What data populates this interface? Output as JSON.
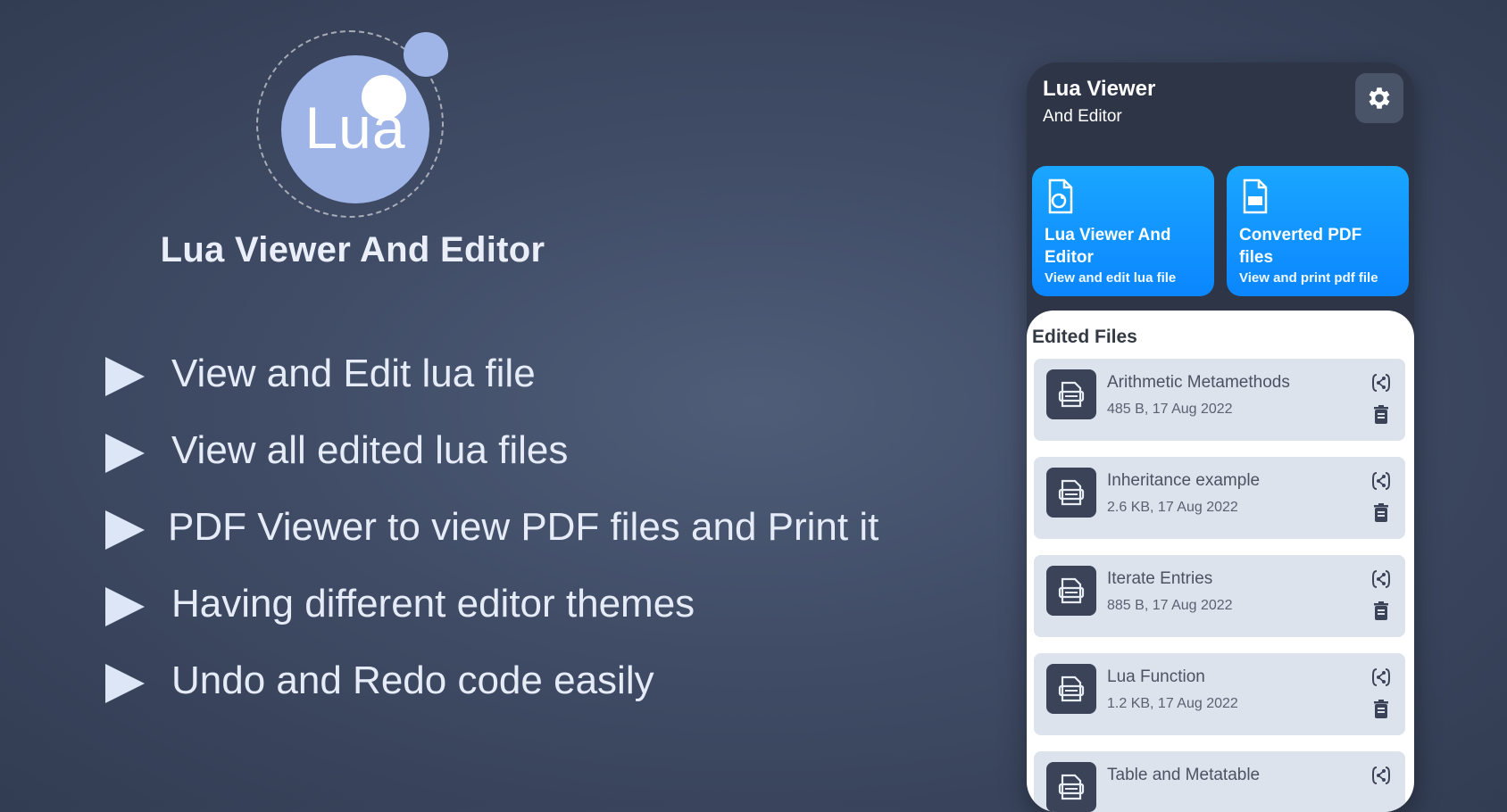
{
  "logo": {
    "text": "Lua"
  },
  "promo": {
    "app_title": "Lua Viewer And Editor",
    "features": [
      "View and Edit lua file",
      "View all edited lua files",
      "PDF Viewer to view PDF files and Print it",
      "Having different editor themes",
      "Undo and Redo code easily"
    ]
  },
  "phone": {
    "header": {
      "title": "Lua Viewer",
      "subtitle": "And Editor",
      "settings_icon": "gear-icon"
    },
    "cards": [
      {
        "title": "Lua Viewer And Editor",
        "desc": "View and edit lua file",
        "icon": "lua-file-icon"
      },
      {
        "title": "Converted PDF files",
        "desc": "View and print pdf file",
        "icon": "pdf-file-icon"
      }
    ],
    "edited_files": {
      "title": "Edited Files",
      "items": [
        {
          "name": "Arithmetic Metamethods",
          "meta": "485 B, 17 Aug 2022"
        },
        {
          "name": "Inheritance example",
          "meta": "2.6 KB, 17 Aug 2022"
        },
        {
          "name": "Iterate Entries",
          "meta": "885 B, 17 Aug 2022"
        },
        {
          "name": "Lua Function",
          "meta": "1.2 KB, 17 Aug 2022"
        },
        {
          "name": "Table and Metatable",
          "meta": ""
        }
      ]
    }
  },
  "colors": {
    "background": "#404c66",
    "accent_blue": "#0b86ff",
    "logo_blue": "#9fb5e8",
    "phone_dark": "#2d3547",
    "item_bg": "#dde3ec"
  }
}
